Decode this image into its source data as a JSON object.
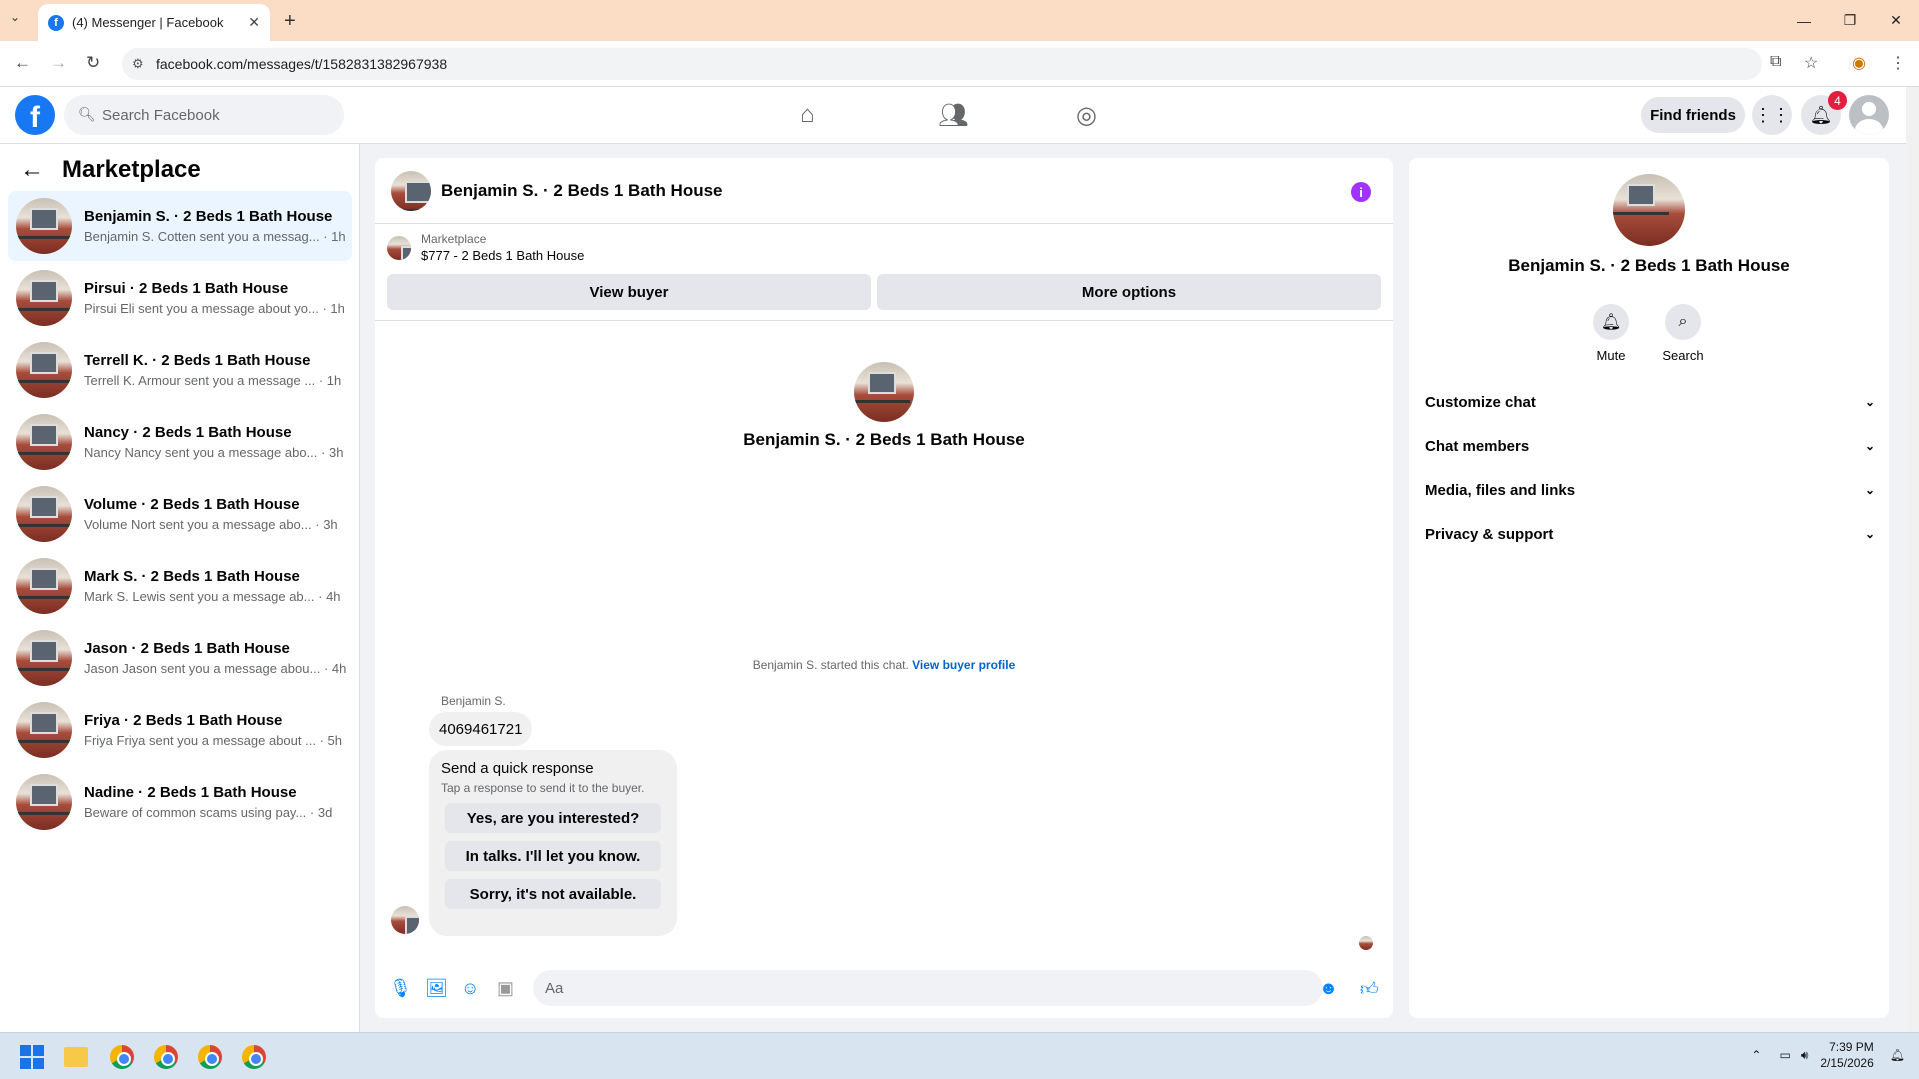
{
  "browser": {
    "tab_title": "(4) Messenger | Facebook",
    "url": "facebook.com/messages/t/1582831382967938"
  },
  "header": {
    "search_placeholder": "Search Facebook",
    "find_friends": "Find friends",
    "notification_count": "4"
  },
  "sidebar": {
    "title": "Marketplace",
    "conversations": [
      {
        "name": "Benjamin S. · 2 Beds 1 Bath House",
        "preview": "Benjamin S. Cotten sent you a messag...",
        "time": "· 1h"
      },
      {
        "name": "Pirsui · 2 Beds 1 Bath House",
        "preview": "Pirsui Eli sent you a message about yo...",
        "time": "· 1h"
      },
      {
        "name": "Terrell K. · 2 Beds 1 Bath House",
        "preview": "Terrell K. Armour sent you a message ...",
        "time": "· 1h"
      },
      {
        "name": "Nancy · 2 Beds 1 Bath House",
        "preview": "Nancy Nancy sent you a message abo...",
        "time": "· 3h"
      },
      {
        "name": "Volume · 2 Beds 1 Bath House",
        "preview": "Volume Nort sent you a message abo...",
        "time": "· 3h"
      },
      {
        "name": "Mark S. · 2 Beds 1 Bath House",
        "preview": "Mark S. Lewis sent you a message ab...",
        "time": "· 4h"
      },
      {
        "name": "Jason · 2 Beds 1 Bath House",
        "preview": "Jason Jason sent you a message abou...",
        "time": "· 4h"
      },
      {
        "name": "Friya · 2 Beds 1 Bath House",
        "preview": "Friya Friya sent you a message about ...",
        "time": "· 5h"
      },
      {
        "name": "Nadine · 2 Beds 1 Bath House",
        "preview": "Beware of common scams using pay...",
        "time": "· 3d"
      }
    ]
  },
  "chat": {
    "title": "Benjamin S. · 2 Beds 1 Bath House",
    "marketplace_label": "Marketplace",
    "listing": "$777 - 2 Beds 1 Bath House",
    "view_buyer": "View buyer",
    "more_options": "More options",
    "center_name": "Benjamin S. · 2 Beds 1 Bath House",
    "started_text": "Benjamin S. started this chat.",
    "view_buyer_profile": "View buyer profile",
    "sender": "Benjamin S.",
    "message": "4069461721",
    "quick_title": "Send a quick response",
    "quick_sub": "Tap a response to send it to the buyer.",
    "quick_responses": [
      "Yes, are you interested?",
      "In talks. I'll let you know.",
      "Sorry, it's not available."
    ],
    "composer_placeholder": "Aa"
  },
  "details": {
    "name": "Benjamin S. · 2 Beds 1 Bath House",
    "mute": "Mute",
    "search": "Search",
    "sections": [
      "Customize chat",
      "Chat members",
      "Media, files and links",
      "Privacy & support"
    ]
  },
  "taskbar": {
    "time": "7:39 PM",
    "date": "2/15/2026"
  }
}
